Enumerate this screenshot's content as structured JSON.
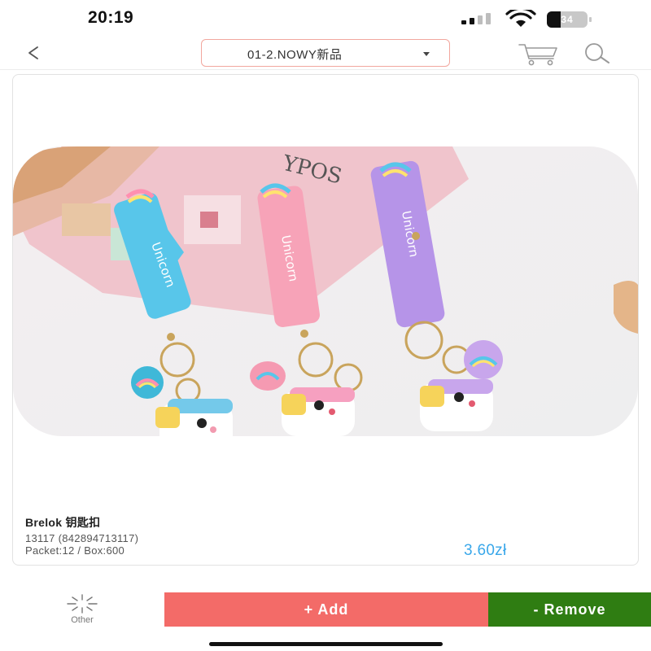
{
  "status_bar": {
    "time": "20:19",
    "battery": "34",
    "battery_level": 0.34,
    "signal_bars": 2
  },
  "nav": {
    "category": "01-2.NOWY新品",
    "back_icon": "chevron-left-icon",
    "cart_icon": "cart-icon",
    "search_icon": "search-icon"
  },
  "product": {
    "name": "Brelok 钥匙扣",
    "code": "13117 (842894713117)",
    "packaging": "Packet:12 / Box:600",
    "price": "3.60zł",
    "image": {
      "name": "product-photo",
      "strap_colors": [
        "#58c6ea",
        "#f7a3b8",
        "#b694e8"
      ],
      "strap_texts": [
        "Unicorn",
        "Unicorn",
        "Unicorn"
      ],
      "package_text": "YPOS"
    }
  },
  "actions": {
    "other": "Other",
    "add": "+ Add",
    "remove": "- Remove"
  },
  "colors": {
    "accent_blue": "#39a7ea",
    "add_red": "#f36b68",
    "remove_green": "#2f7d12",
    "category_border": "#f2a79e"
  }
}
